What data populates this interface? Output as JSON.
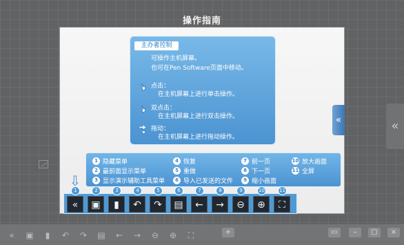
{
  "title": "操作指南",
  "guide": {
    "heading": "主办者控制",
    "intro": [
      "可操作主机屏幕。",
      "也可在Pen Software页面中移动。"
    ],
    "click_title": "点击：",
    "click_desc": "在主机屏幕上进行单击操作。",
    "double_title": "双点击：",
    "double_desc": "在主机屏幕上进行双击操作。",
    "drag_title": "拖动：",
    "drag_desc": "在主机屏幕上进行拖动操作。"
  },
  "legend": [
    {
      "num": "1",
      "label": "隐藏菜单"
    },
    {
      "num": "2",
      "label": "最前面显示菜单"
    },
    {
      "num": "3",
      "label": "显示演示辅助工具菜单"
    },
    {
      "num": "4",
      "label": "恢复"
    },
    {
      "num": "5",
      "label": "重做"
    },
    {
      "num": "6",
      "label": "导入已发送的文件"
    },
    {
      "num": "7",
      "label": "前一页"
    },
    {
      "num": "8",
      "label": "下一页"
    },
    {
      "num": "9",
      "label": "缩小画面"
    },
    {
      "num": "10",
      "label": "放大画面"
    },
    {
      "num": "11",
      "label": "全屏"
    }
  ],
  "toolbar": [
    {
      "num": "1",
      "icon": "double-chevron-left-icon"
    },
    {
      "num": "2",
      "icon": "menu-front-icon"
    },
    {
      "num": "3",
      "icon": "presentation-tool-icon"
    },
    {
      "num": "4",
      "icon": "undo-icon"
    },
    {
      "num": "5",
      "icon": "redo-icon"
    },
    {
      "num": "6",
      "icon": "import-file-icon"
    },
    {
      "num": "7",
      "icon": "left-arrow-icon"
    },
    {
      "num": "8",
      "icon": "right-arrow-icon"
    },
    {
      "num": "9",
      "icon": "zoom-out-icon"
    },
    {
      "num": "10",
      "icon": "zoom-in-icon"
    },
    {
      "num": "11",
      "icon": "fullscreen-icon"
    }
  ],
  "colors": {
    "panel_blue": "#4f9ad4",
    "dark_button": "#20272f",
    "background": "#616264"
  }
}
